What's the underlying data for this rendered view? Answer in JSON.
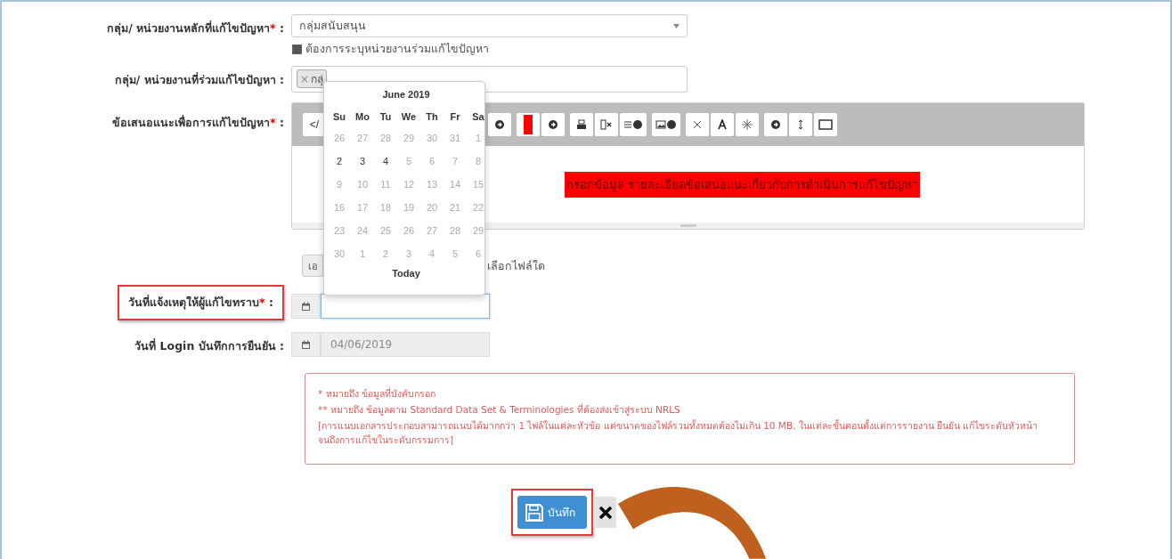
{
  "main_group": {
    "label": "กลุ่ม/ หน่วยงานหลักที่แก้ไขปัญหา",
    "required_mark": "*",
    "colon": ":",
    "value": "กลุ่มสนับสนุน"
  },
  "joint_checkbox": {
    "label": "ต้องการระบุหน่วยงานร่วมแก้ไขปัญหา",
    "checked": true
  },
  "joint_group": {
    "label": "กลุ่ม/ หน่วยงานที่ร่วมแก้ไขปัญหา",
    "colon": ":",
    "tags": [
      {
        "remove": "×",
        "label": "กลุ่"
      }
    ]
  },
  "suggestion": {
    "label": "ข้อเสนอแนะเพื่อการแก้ไขปัญหา",
    "required_mark": "*",
    "colon": ":",
    "code_button": "</",
    "placeholder": "กรอกข้อมูล รายละเอียดข้อเสนอแนะเกี่ยวกับการดำเนินการแก้ไขปัญหา"
  },
  "file": {
    "button": "เอ",
    "status": "เลือกไฟล์ใด"
  },
  "notify_date": {
    "label": "วันที่แจ้งเหตุให้ผู้แก้ไขทราบ",
    "required_mark": "*",
    "colon": ":",
    "highlighted": true
  },
  "login_date": {
    "label": "วันที่ Login บันทึกการยืนยัน",
    "colon": ":",
    "value": "04/06/2019"
  },
  "notes": [
    "* หมายถึง ข้อมูลที่บังคับกรอก",
    "** หมายถึง ข้อมูลตาม Standard Data Set & Terminologies ที่ต้องส่งเข้าสู่ระบบ NRLS",
    "[การแนบเอกสารประกอบสามารถแนบได้มากกว่า 1 ไฟล์ในแต่ละหัวข้อ แต่ขนาดของไฟล์รวมทั้งหมดต้องไม่เกิน 10 MB. ในแต่ละขั้นตอนตั้งแต่การรายงาน ยืนยัน แก้ไขระดับหัวหน้า จนถึงการแก้ไขในระดับกรรมการ]"
  ],
  "save_button": {
    "label": "บันทึก",
    "highlighted": true
  },
  "calendar": {
    "title": "June 2019",
    "weekdays": [
      "Su",
      "Mo",
      "Tu",
      "We",
      "Th",
      "Fr",
      "Sa"
    ],
    "today": "Today",
    "weeks": [
      [
        {
          "label": "26",
          "disabled": true
        },
        {
          "label": "27",
          "disabled": true
        },
        {
          "label": "28",
          "disabled": true
        },
        {
          "label": "29",
          "disabled": true
        },
        {
          "label": "30",
          "disabled": true
        },
        {
          "label": "31",
          "disabled": true
        },
        {
          "label": "1",
          "disabled": true
        }
      ],
      [
        {
          "label": "2",
          "disabled": false
        },
        {
          "label": "3",
          "disabled": false
        },
        {
          "label": "4",
          "disabled": false
        },
        {
          "label": "5",
          "disabled": true
        },
        {
          "label": "6",
          "disabled": true
        },
        {
          "label": "7",
          "disabled": true
        },
        {
          "label": "8",
          "disabled": true
        }
      ],
      [
        {
          "label": "9",
          "disabled": true
        },
        {
          "label": "10",
          "disabled": true
        },
        {
          "label": "11",
          "disabled": true
        },
        {
          "label": "12",
          "disabled": true
        },
        {
          "label": "13",
          "disabled": true
        },
        {
          "label": "14",
          "disabled": true
        },
        {
          "label": "15",
          "disabled": true
        }
      ],
      [
        {
          "label": "16",
          "disabled": true
        },
        {
          "label": "17",
          "disabled": true
        },
        {
          "label": "18",
          "disabled": true
        },
        {
          "label": "19",
          "disabled": true
        },
        {
          "label": "20",
          "disabled": true
        },
        {
          "label": "21",
          "disabled": true
        },
        {
          "label": "22",
          "disabled": true
        }
      ],
      [
        {
          "label": "23",
          "disabled": true
        },
        {
          "label": "24",
          "disabled": true
        },
        {
          "label": "25",
          "disabled": true
        },
        {
          "label": "26",
          "disabled": true
        },
        {
          "label": "27",
          "disabled": true
        },
        {
          "label": "28",
          "disabled": true
        },
        {
          "label": "29",
          "disabled": true
        }
      ],
      [
        {
          "label": "30",
          "disabled": true
        },
        {
          "label": "1",
          "disabled": true
        },
        {
          "label": "2",
          "disabled": true
        },
        {
          "label": "3",
          "disabled": true
        },
        {
          "label": "4",
          "disabled": true
        },
        {
          "label": "5",
          "disabled": true
        },
        {
          "label": "6",
          "disabled": true
        }
      ]
    ]
  }
}
